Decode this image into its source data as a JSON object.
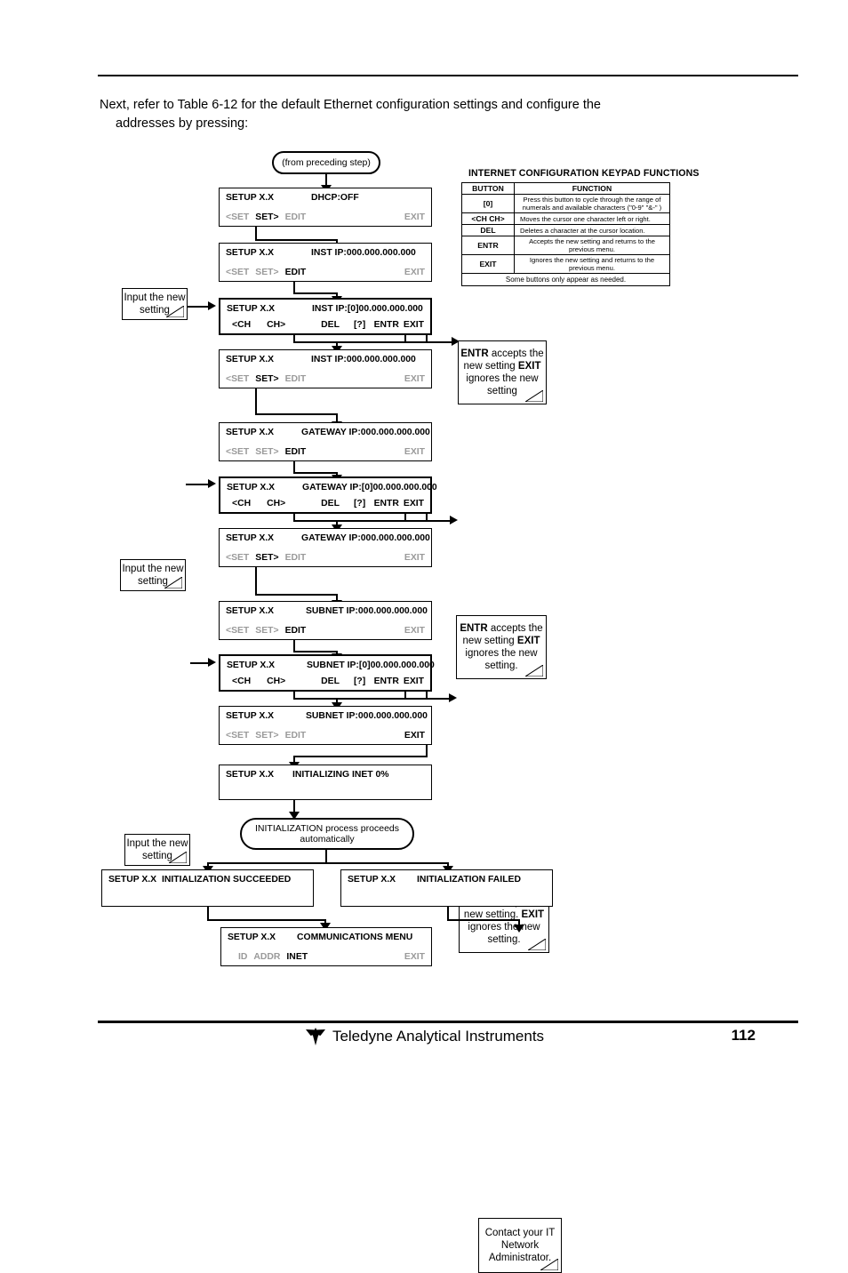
{
  "document": {
    "intro_line1": "Next, refer to Table 6-12 for the default Ethernet configuration settings and configure the",
    "intro_line2": "addresses by pressing:",
    "footer_company": "Teledyne Analytical Instruments",
    "page_number": "112"
  },
  "keypad_table": {
    "title": "INTERNET CONFIGURATION   KEYPAD FUNCTIONS",
    "headers": [
      "BUTTON",
      "FUNCTION"
    ],
    "rows": [
      {
        "button": "[0]",
        "function": "Press this button to cycle through the range of numerals and available characters  (\"0-9\"   \"&-\"  )"
      },
      {
        "button": "<CH  CH>",
        "function": "Moves the cursor one character left or right."
      },
      {
        "button": "DEL",
        "function": "Deletes a character at the cursor location."
      },
      {
        "button": "ENTR",
        "function": "Accepts the new setting and returns to the previous menu."
      },
      {
        "button": "EXIT",
        "function": "Ignores the new setting and returns to the previous menu."
      }
    ],
    "footnote": "Some buttons only appear as needed."
  },
  "flow": {
    "start": "(from preceding step)",
    "auto": "INITIALIZATION process proceeds automatically",
    "screens": {
      "dhcp": {
        "label": "SETUP X.X",
        "value": "DHCP:OFF",
        "keys": [
          "<SET",
          "SET>",
          "EDIT"
        ],
        "active": [
          "SET>"
        ],
        "exit": "EXIT",
        "exit_active": false
      },
      "inst_ip_1": {
        "label": "SETUP X.X",
        "value": "INST IP:000.000.000.000",
        "keys": [
          "<SET",
          "SET>",
          "EDIT"
        ],
        "active": [
          "EDIT"
        ],
        "exit": "EXIT",
        "exit_active": false
      },
      "inst_ip_edit": {
        "label": "SETUP X.X",
        "value_pre": "INST IP:",
        "value_cursor": "[0]",
        "value_post": "00.000.000.000",
        "keys": [
          "<CH",
          "CH>",
          "DEL",
          "[?]"
        ],
        "right_keys": [
          "ENTR",
          "EXIT"
        ]
      },
      "inst_ip_2": {
        "label": "SETUP X.X",
        "value": "INST IP:000.000.000.000",
        "keys": [
          "<SET",
          "SET>",
          "EDIT"
        ],
        "active": [
          "SET>"
        ],
        "exit": "EXIT",
        "exit_active": false
      },
      "gateway_1": {
        "label": "SETUP X.X",
        "value": "GATEWAY IP:000.000.000.000",
        "keys": [
          "<SET",
          "SET>",
          "EDIT"
        ],
        "active": [
          "EDIT"
        ],
        "exit": "EXIT",
        "exit_active": false
      },
      "gateway_edit": {
        "label": "SETUP X.X",
        "value_pre": "GATEWAY IP:",
        "value_cursor": "[0]",
        "value_post": "00.000.000.000",
        "keys": [
          "<CH",
          "CH>",
          "DEL",
          "[?]"
        ],
        "right_keys": [
          "ENTR",
          "EXIT"
        ]
      },
      "gateway_2": {
        "label": "SETUP X.X",
        "value": "GATEWAY IP:000.000.000.000",
        "keys": [
          "<SET",
          "SET>",
          "EDIT"
        ],
        "active": [
          "SET>"
        ],
        "exit": "EXIT",
        "exit_active": false
      },
      "subnet_1": {
        "label": "SETUP X.X",
        "value": "SUBNET IP:000.000.000.000",
        "keys": [
          "<SET",
          "SET>",
          "EDIT"
        ],
        "active": [
          "EDIT"
        ],
        "exit": "EXIT",
        "exit_active": false
      },
      "subnet_edit": {
        "label": "SETUP X.X",
        "value_pre": "SUBNET IP:",
        "value_cursor": "[0]",
        "value_post": "00.000.000.000",
        "keys": [
          "<CH",
          "CH>",
          "DEL",
          "[?]"
        ],
        "right_keys": [
          "ENTR",
          "EXIT"
        ]
      },
      "subnet_2": {
        "label": "SETUP X.X",
        "value": "SUBNET IP:000.000.000.000",
        "keys": [
          "<SET",
          "SET>",
          "EDIT"
        ],
        "active": [],
        "exit": "EXIT",
        "exit_active": true
      },
      "initializing": {
        "label": "SETUP X.X",
        "value": "INITIALIZING INET  0%"
      },
      "succeeded": {
        "label": "SETUP X.X",
        "value": "INITIALIZATION SUCCEEDED"
      },
      "failed": {
        "label": "SETUP X.X",
        "value": "INITIALIZATION FAILED"
      },
      "comm_menu": {
        "label": "SETUP X.X",
        "value": "COMMUNICATIONS MENU",
        "keys": [
          "ID",
          "ADDR",
          "INET"
        ],
        "active": [
          "INET"
        ],
        "exit": "EXIT",
        "exit_active": false
      }
    },
    "notes": {
      "input_1": "Input the new setting",
      "input_2": "Input the new setting",
      "input_3": "Input the new setting",
      "entr_exit_1_a": "ENTR",
      "entr_exit_1_b": " accepts the new setting ",
      "entr_exit_1_c": "EXIT",
      "entr_exit_1_d": " ignores the new setting",
      "entr_exit_2_d": " ignores the new setting.",
      "entr_exit_2_b": " accepts the new setting. ",
      "contact": "Contact your IT Network Administrator."
    }
  }
}
